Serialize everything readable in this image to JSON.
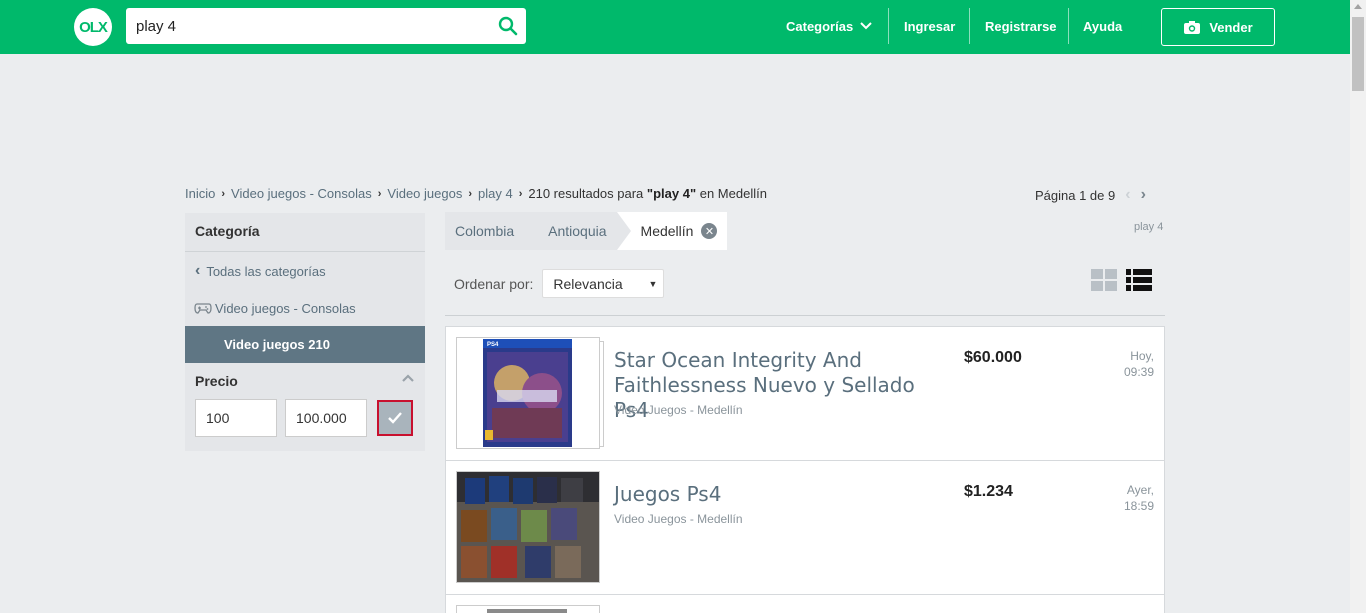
{
  "header": {
    "logo": "OLX",
    "search_value": "play 4",
    "nav": {
      "categorias": "Categorías",
      "ingresar": "Ingresar",
      "registrarse": "Registrarse",
      "ayuda": "Ayuda",
      "vender": "Vender"
    },
    "brand_color": "#00b96b"
  },
  "breadcrumb": {
    "items": [
      "Inicio",
      "Video juegos - Consolas",
      "Video juegos",
      "play 4"
    ],
    "results_prefix": "210 resultados para",
    "query": "\"play 4\"",
    "results_suffix": "en Medellín"
  },
  "pagination": {
    "label": "Página 1 de 9"
  },
  "sidebar": {
    "category_title": "Categoría",
    "all_categories": "Todas las categorías",
    "parent_category": "Video juegos - Consolas",
    "active_category": "Video juegos 210",
    "price_title": "Precio",
    "price_min": "100",
    "price_max": "100.000"
  },
  "location": {
    "country": "Colombia",
    "region": "Antioquia",
    "city": "Medellín"
  },
  "query_tag": "play 4",
  "sort": {
    "label": "Ordenar por:",
    "selected": "Relevancia"
  },
  "listings": [
    {
      "title": "Star Ocean Integrity And Faithlessness Nuevo y Sellado Ps4",
      "subtitle": "Video Juegos - Medellín",
      "price": "$60.000",
      "when_day": "Hoy,",
      "when_time": "09:39"
    },
    {
      "title": "Juegos Ps4",
      "subtitle": "Video Juegos - Medellín",
      "price": "$1.234",
      "when_day": "Ayer,",
      "when_time": "18:59"
    }
  ]
}
